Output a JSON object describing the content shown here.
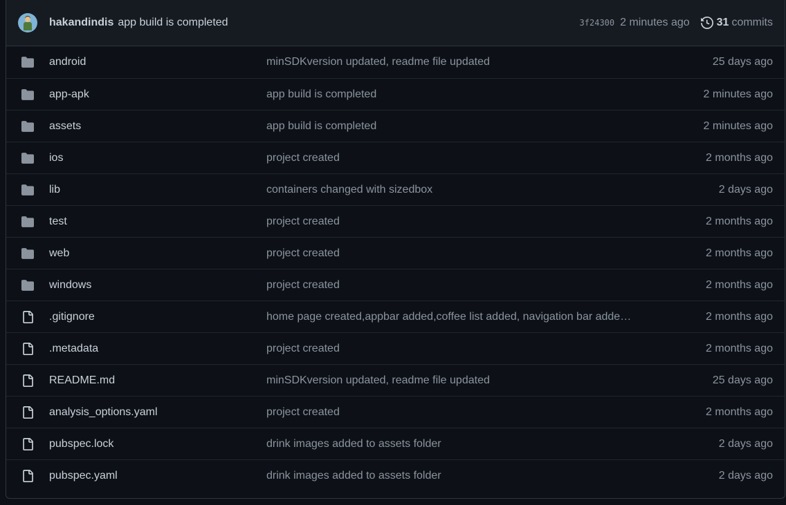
{
  "latest_commit": {
    "author": "hakandindis",
    "message": "app build is completed",
    "sha": "3f24300",
    "time_ago": "2 minutes ago",
    "commit_count": "31",
    "commits_label": "commits"
  },
  "colors": {
    "background": "#0d1117",
    "header_bg": "#161b22",
    "border": "#30363d",
    "text": "#c9d1d9",
    "muted": "#8b949e",
    "folder_icon": "#8b949e"
  },
  "files": [
    {
      "type": "folder",
      "icon": "folder-icon",
      "name": "android",
      "message": "minSDKversion updated, readme file updated",
      "age": "25 days ago"
    },
    {
      "type": "folder",
      "icon": "folder-icon",
      "name": "app-apk",
      "message": "app build is completed",
      "age": "2 minutes ago"
    },
    {
      "type": "folder",
      "icon": "folder-icon",
      "name": "assets",
      "message": "app build is completed",
      "age": "2 minutes ago"
    },
    {
      "type": "folder",
      "icon": "folder-icon",
      "name": "ios",
      "message": "project created",
      "age": "2 months ago"
    },
    {
      "type": "folder",
      "icon": "folder-icon",
      "name": "lib",
      "message": "containers changed with sizedbox",
      "age": "2 days ago"
    },
    {
      "type": "folder",
      "icon": "folder-icon",
      "name": "test",
      "message": "project created",
      "age": "2 months ago"
    },
    {
      "type": "folder",
      "icon": "folder-icon",
      "name": "web",
      "message": "project created",
      "age": "2 months ago"
    },
    {
      "type": "folder",
      "icon": "folder-icon",
      "name": "windows",
      "message": "project created",
      "age": "2 months ago"
    },
    {
      "type": "file",
      "icon": "file-icon",
      "name": ".gitignore",
      "message": "home page created,appbar added,coffee list added, navigation bar adde…",
      "age": "2 months ago"
    },
    {
      "type": "file",
      "icon": "file-icon",
      "name": ".metadata",
      "message": "project created",
      "age": "2 months ago"
    },
    {
      "type": "file",
      "icon": "file-icon",
      "name": "README.md",
      "message": "minSDKversion updated, readme file updated",
      "age": "25 days ago"
    },
    {
      "type": "file",
      "icon": "file-icon",
      "name": "analysis_options.yaml",
      "message": "project created",
      "age": "2 months ago"
    },
    {
      "type": "file",
      "icon": "file-icon",
      "name": "pubspec.lock",
      "message": "drink images added to assets folder",
      "age": "2 days ago"
    },
    {
      "type": "file",
      "icon": "file-icon",
      "name": "pubspec.yaml",
      "message": "drink images added to assets folder",
      "age": "2 days ago"
    }
  ]
}
